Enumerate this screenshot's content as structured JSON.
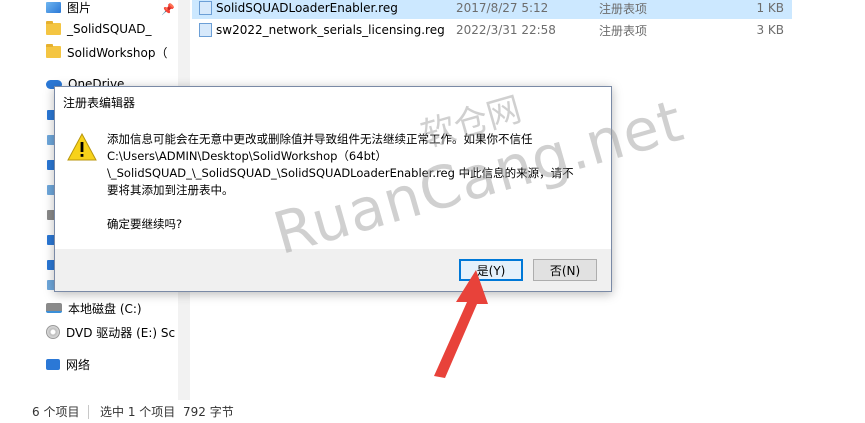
{
  "nav": {
    "items": [
      {
        "label": "图片",
        "icon": "image-icon"
      },
      {
        "label": "_SolidSQUAD_",
        "icon": "folder-icon"
      },
      {
        "label": "SolidWorkshop（",
        "icon": "folder-icon"
      },
      {
        "label": "OneDrive",
        "icon": "cloud-icon"
      },
      {
        "label": "本地磁盘 (C:)",
        "icon": "drive-icon"
      },
      {
        "label": "DVD 驱动器 (E:) Sc",
        "icon": "dvd-icon"
      },
      {
        "label": "网络",
        "icon": "network-icon"
      }
    ]
  },
  "files": [
    {
      "name": "SolidSQUADLoaderEnabler.reg",
      "date": "2017/8/27 5:12",
      "type": "注册表项",
      "size": "1 KB",
      "selected": true
    },
    {
      "name": "sw2022_network_serials_licensing.reg",
      "date": "2022/3/31 22:58",
      "type": "注册表项",
      "size": "3 KB",
      "selected": false
    }
  ],
  "status": {
    "count": "6 个项目",
    "selected": "选中 1 个项目",
    "size": "792 字节"
  },
  "dialog": {
    "title": "注册表编辑器",
    "message_lines": [
      "添加信息可能会在无意中更改或删除值并导致组件无法继续正常工作。如果你不信任",
      "C:\\Users\\ADMIN\\Desktop\\SolidWorkshop（64bt）",
      "\\_SolidSQUAD_\\_SolidSQUAD_\\SolidSQUADLoaderEnabler.reg 中此信息的来源，请不",
      "要将其添加到注册表中。"
    ],
    "confirm": "确定要继续吗?",
    "yes_label": "是(Y)",
    "no_label": "否(N)"
  },
  "watermark": {
    "small": "软仓网",
    "big": "RuanCang.net"
  },
  "colors": {
    "selection": "#cce8ff",
    "accent": "#0078d7",
    "arrow": "#e8423a",
    "warning": "#f7d21a"
  }
}
